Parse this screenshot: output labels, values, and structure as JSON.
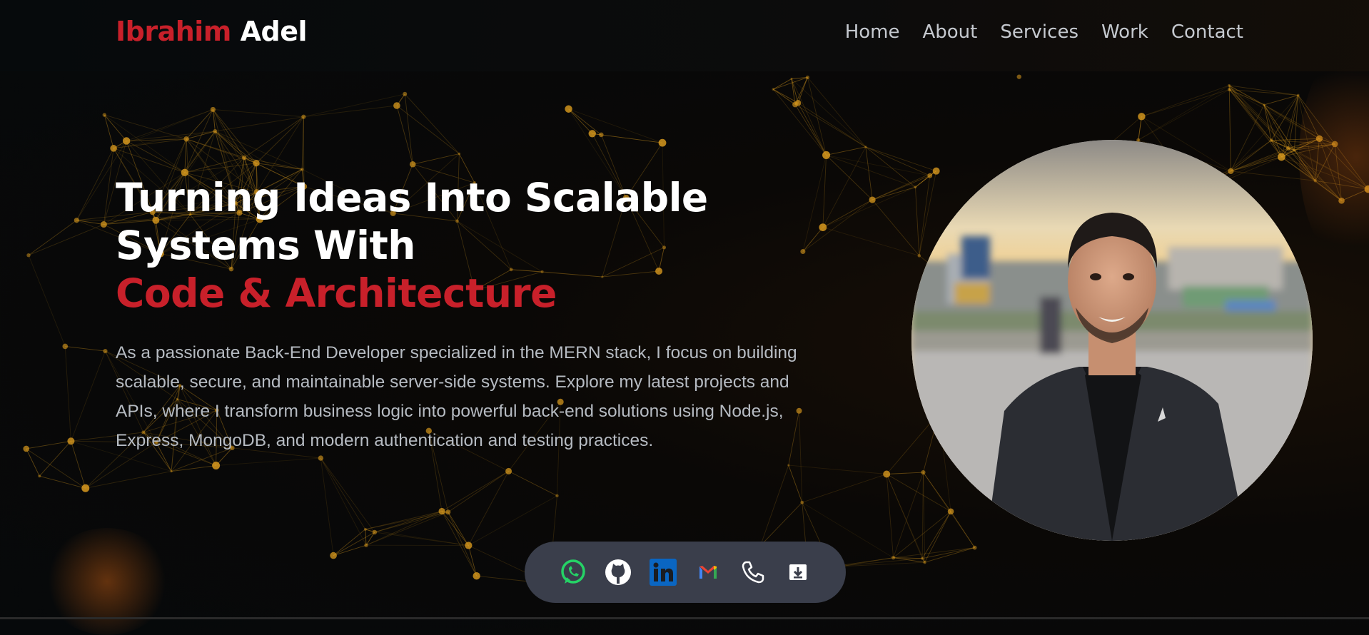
{
  "header": {
    "logo_first": "Ibrahim",
    "logo_last": "Adel",
    "nav": [
      {
        "label": "Home"
      },
      {
        "label": "About"
      },
      {
        "label": "Services"
      },
      {
        "label": "Work"
      },
      {
        "label": "Contact"
      }
    ]
  },
  "hero": {
    "title_line1": "Turning Ideas Into Scalable",
    "title_line2": "Systems With",
    "title_accent": "Code & Architecture",
    "description": "As a passionate Back-End Developer specialized in the MERN stack, I focus on building scalable, secure, and maintainable server-side systems. Explore my latest projects and APIs, where I transform business logic into powerful back-end solutions using Node.js, Express, MongoDB, and modern authentication and testing practices."
  },
  "social": [
    {
      "icon": "whatsapp-icon"
    },
    {
      "icon": "github-icon"
    },
    {
      "icon": "linkedin-icon"
    },
    {
      "icon": "gmail-icon"
    },
    {
      "icon": "phone-icon"
    },
    {
      "icon": "download-cv-icon"
    }
  ],
  "colors": {
    "accent": "#c8202a",
    "background": "#06090b",
    "network": "#d99a1e",
    "social_bar": "#3a3e4b",
    "nav_text": "#c5c9cf",
    "body_text": "#b6bbc2"
  }
}
